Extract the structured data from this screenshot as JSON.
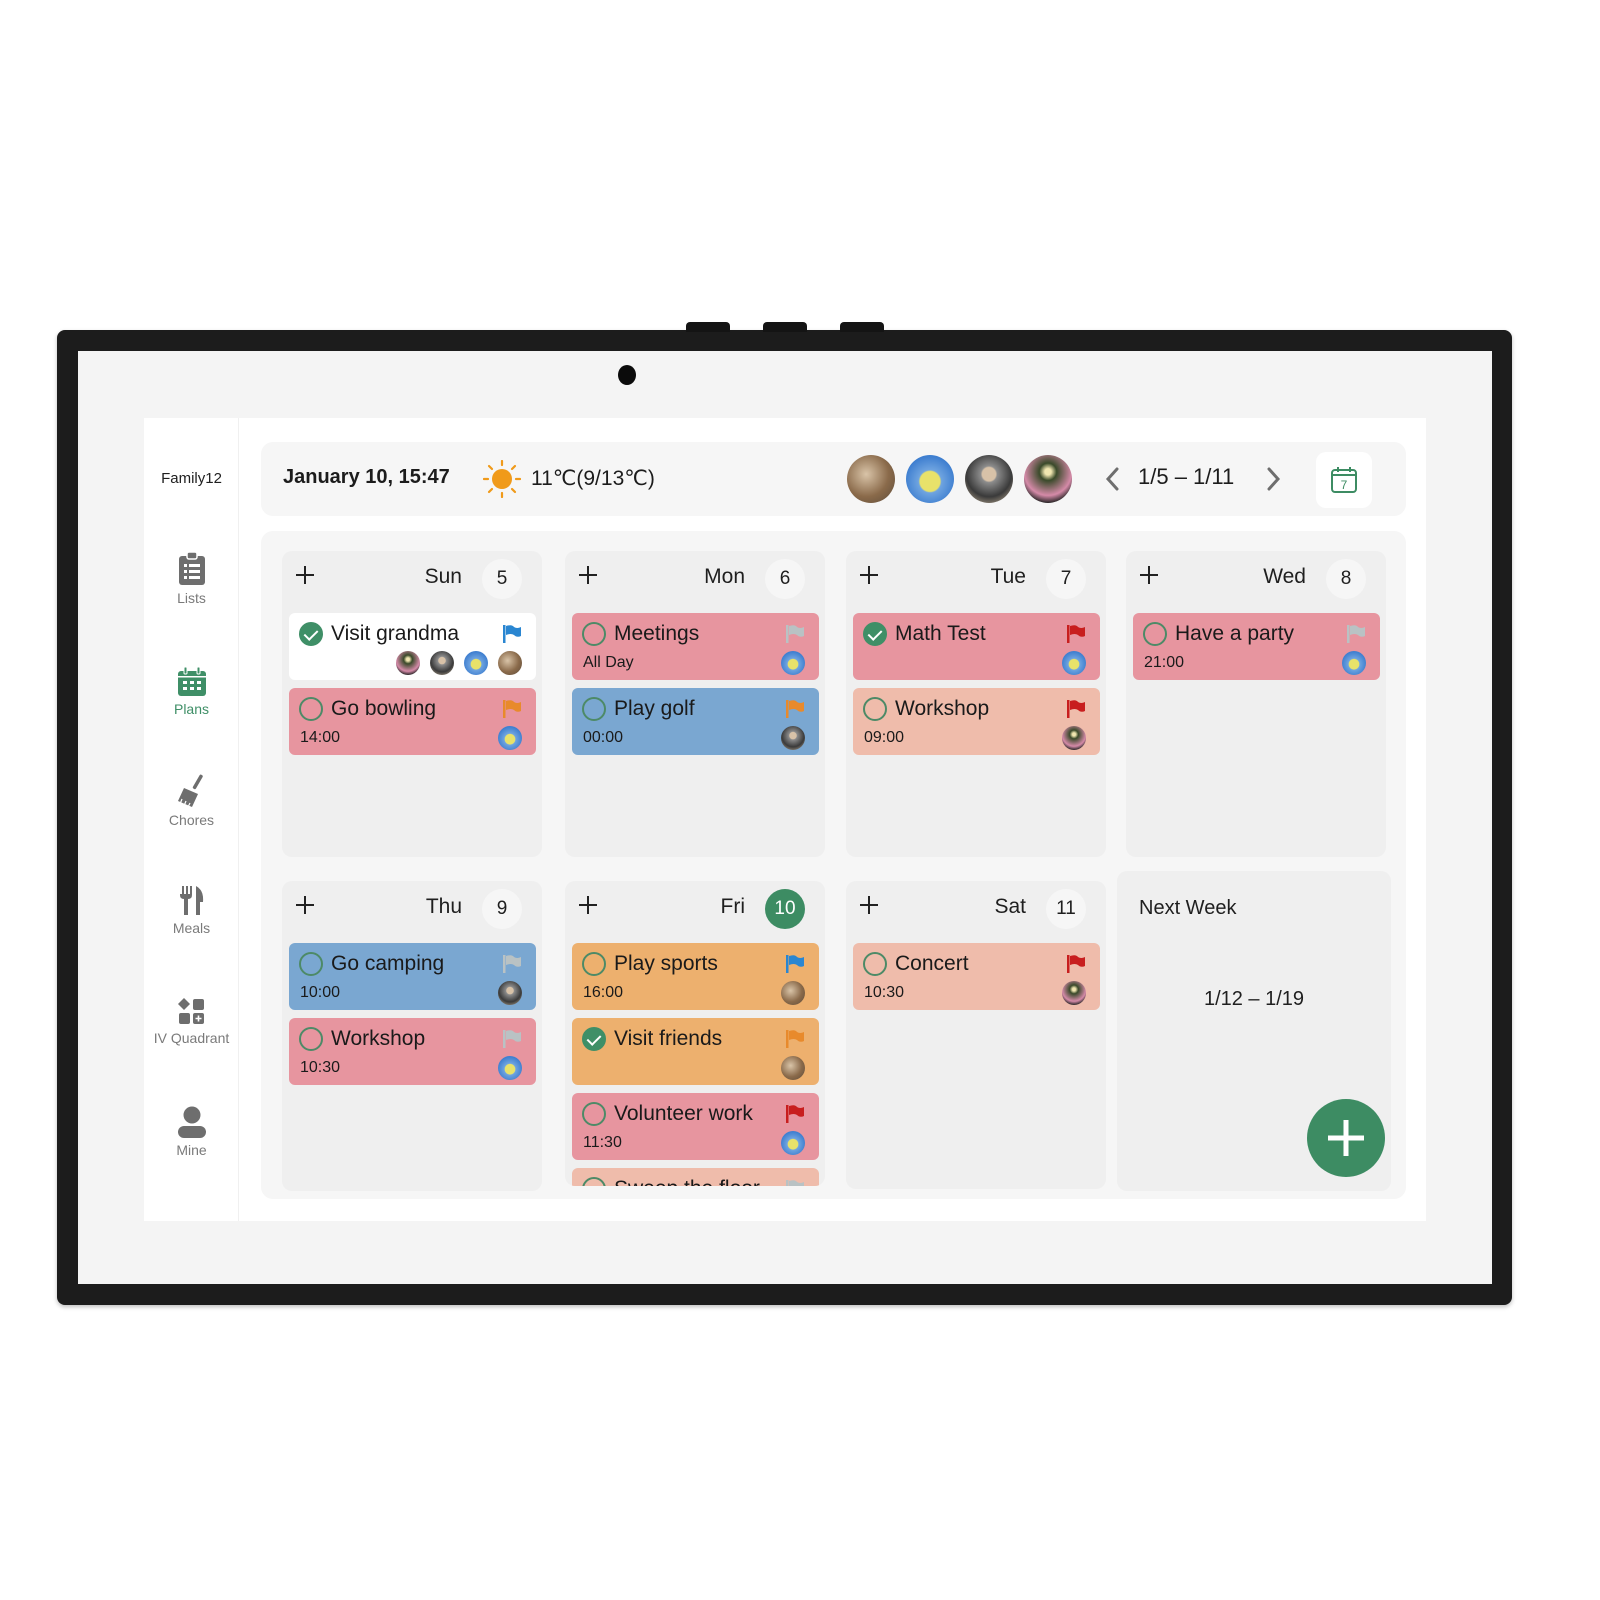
{
  "app": {
    "family_name": "Family12",
    "nav": [
      {
        "id": "lists",
        "label": "Lists",
        "icon": "clipboard-list-icon",
        "active": false
      },
      {
        "id": "plans",
        "label": "Plans",
        "icon": "calendar-icon",
        "active": true
      },
      {
        "id": "chores",
        "label": "Chores",
        "icon": "broom-icon",
        "active": false
      },
      {
        "id": "meals",
        "label": "Meals",
        "icon": "fork-knife-icon",
        "active": false
      },
      {
        "id": "quadrant",
        "label": "IV Quadrant",
        "icon": "quadrant-icon",
        "active": false
      },
      {
        "id": "mine",
        "label": "Mine",
        "icon": "person-icon",
        "active": false
      }
    ]
  },
  "header": {
    "datetime": "January 10, 15:47",
    "weather_icon": "sun-icon",
    "weather": "11℃(9/13℃)",
    "members": [
      "member-1",
      "member-2",
      "member-3",
      "member-4"
    ],
    "week_range": "1/5 – 1/11",
    "today_icon_day": "7"
  },
  "colors": {
    "accent": "#3d8c63",
    "pink": "#e7959f",
    "blue": "#7aa7d1",
    "peach": "#efbcab",
    "orange": "#edb06e",
    "flag_blue": "#2a86d1",
    "flag_orange": "#e88a2c",
    "flag_red": "#c81e1e",
    "flag_gray": "#b9c2c4"
  },
  "days": [
    {
      "name": "Sun",
      "num": "5",
      "today": false,
      "tasks": [
        {
          "title": "Visit grandma",
          "time": "",
          "done": true,
          "color": "white",
          "flag": "blue",
          "assignees": [
            "member-4",
            "member-3",
            "member-2",
            "member-1"
          ]
        },
        {
          "title": "Go bowling",
          "time": "14:00",
          "done": false,
          "color": "pink",
          "flag": "orange",
          "assignees": [
            "member-2"
          ]
        }
      ]
    },
    {
      "name": "Mon",
      "num": "6",
      "today": false,
      "tasks": [
        {
          "title": "Meetings",
          "time": "All Day",
          "done": false,
          "color": "pink",
          "flag": "gray",
          "assignees": [
            "member-2"
          ]
        },
        {
          "title": "Play golf",
          "time": "00:00",
          "done": false,
          "color": "blue",
          "flag": "orange",
          "assignees": [
            "member-3"
          ]
        }
      ]
    },
    {
      "name": "Tue",
      "num": "7",
      "today": false,
      "tasks": [
        {
          "title": "Math Test",
          "time": "",
          "done": true,
          "color": "pink",
          "flag": "red",
          "assignees": [
            "member-2"
          ]
        },
        {
          "title": "Workshop",
          "time": "09:00",
          "done": false,
          "color": "peach",
          "flag": "red",
          "assignees": [
            "member-4"
          ]
        }
      ]
    },
    {
      "name": "Wed",
      "num": "8",
      "today": false,
      "tasks": [
        {
          "title": "Have a party",
          "time": "21:00",
          "done": false,
          "color": "pink",
          "flag": "gray",
          "assignees": [
            "member-2"
          ]
        }
      ]
    },
    {
      "name": "Thu",
      "num": "9",
      "today": false,
      "tasks": [
        {
          "title": "Go camping",
          "time": "10:00",
          "done": false,
          "color": "blue",
          "flag": "gray",
          "assignees": [
            "member-3"
          ]
        },
        {
          "title": "Workshop",
          "time": "10:30",
          "done": false,
          "color": "pink",
          "flag": "gray",
          "assignees": [
            "member-2"
          ]
        }
      ]
    },
    {
      "name": "Fri",
      "num": "10",
      "today": true,
      "tasks": [
        {
          "title": "Play sports",
          "time": "16:00",
          "done": false,
          "color": "orange",
          "flag": "blue",
          "assignees": [
            "member-1"
          ]
        },
        {
          "title": "Visit friends",
          "time": "",
          "done": true,
          "color": "orange",
          "flag": "orange",
          "assignees": [
            "member-1"
          ]
        },
        {
          "title": "Volunteer work",
          "time": "11:30",
          "done": false,
          "color": "pink",
          "flag": "red",
          "assignees": [
            "member-2"
          ]
        },
        {
          "title": "Sweep the floor",
          "time": "",
          "done": false,
          "color": "peach",
          "flag": "gray",
          "assignees": []
        }
      ]
    },
    {
      "name": "Sat",
      "num": "11",
      "today": false,
      "tasks": [
        {
          "title": "Concert",
          "time": "10:30",
          "done": false,
          "color": "peach",
          "flag": "red",
          "assignees": [
            "member-4"
          ]
        }
      ]
    }
  ],
  "next_week": {
    "title": "Next Week",
    "range": "1/12 – 1/19"
  },
  "fab": {
    "icon": "plus-icon"
  }
}
